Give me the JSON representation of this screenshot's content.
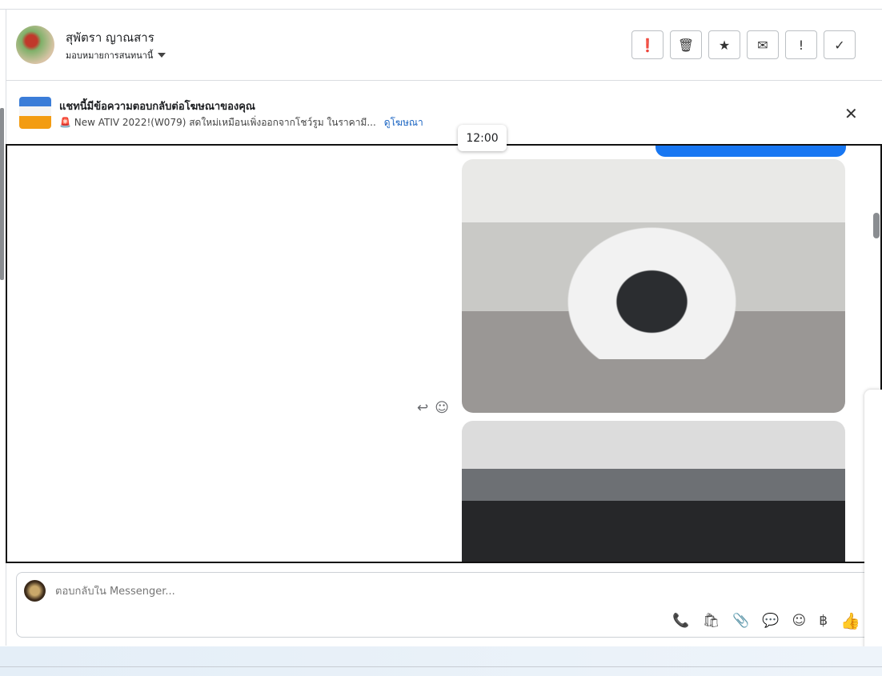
{
  "contact": {
    "name": "สุพัตรา ญาณสาร",
    "assign_label": "มอบหมายการสนทนานี้"
  },
  "actions": [
    {
      "name": "spam",
      "glyph": "❗"
    },
    {
      "name": "delete",
      "glyph": "🗑"
    },
    {
      "name": "star",
      "glyph": "★"
    },
    {
      "name": "mark-unread",
      "glyph": "✉"
    },
    {
      "name": "important",
      "glyph": "!"
    },
    {
      "name": "done",
      "glyph": "✓"
    }
  ],
  "ad": {
    "title": "แชทนี้มีข้อความตอบกลับต่อโฆษณาของคุณ",
    "text": "🚨 New ATIV 2022!(W079) สดใหม่เหมือนเพิ่งออกจากโชว์รูม ในราคามี...",
    "link": "ดูโฆษณา",
    "close": "✕"
  },
  "chat": {
    "timestamp": "12:00",
    "reply_glyph": "↩",
    "emoji_glyph": "☺"
  },
  "composer": {
    "placeholder": "ตอบกลับใน Messenger...",
    "tools": [
      "📞",
      "🛍",
      "📎",
      "💬",
      "☺",
      "฿"
    ],
    "like": "👍"
  },
  "colors": {
    "accent": "#1877f2",
    "link": "#1a64c2"
  }
}
